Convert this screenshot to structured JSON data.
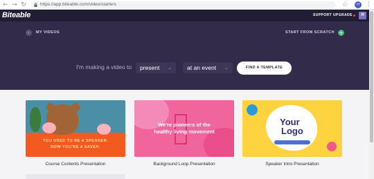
{
  "browser": {
    "back_icon": "arrow-left-icon",
    "forward_icon": "arrow-right-icon",
    "reload_icon": "reload-icon",
    "url": "https://app.biteable.com/video/starters",
    "profile_initial": "H"
  },
  "app": {
    "brand": "Biteable",
    "support_label": "SUPPORT",
    "upgrade_label": "UPGRADE",
    "avatar_initial": "H",
    "colors": {
      "topbar": "#211d34",
      "hero": "#322b4a",
      "accent_green": "#3dbb6e",
      "accent_blue": "#6d9cff"
    }
  },
  "hero": {
    "back_label": "MY VIDEOS",
    "scratch_label": "START FROM SCRATCH",
    "sentence": "I'm making a video to",
    "select_purpose": "present",
    "select_context": "at an event",
    "find_button": "FIND A TEMPLATE"
  },
  "cards": [
    {
      "title": "Course Contents Presentation",
      "thumb_line1": "YOU USED TO BE A SPENDER.",
      "thumb_line2": "NOW YOU'RE A SAVER."
    },
    {
      "title": "Background Loop Presentation",
      "thumb_line1": "We're pioneers of the",
      "thumb_line2": "healthy living movement"
    },
    {
      "title": "Speaker Intro Presentation",
      "thumb_line1": "Your",
      "thumb_line2": "Logo"
    }
  ]
}
